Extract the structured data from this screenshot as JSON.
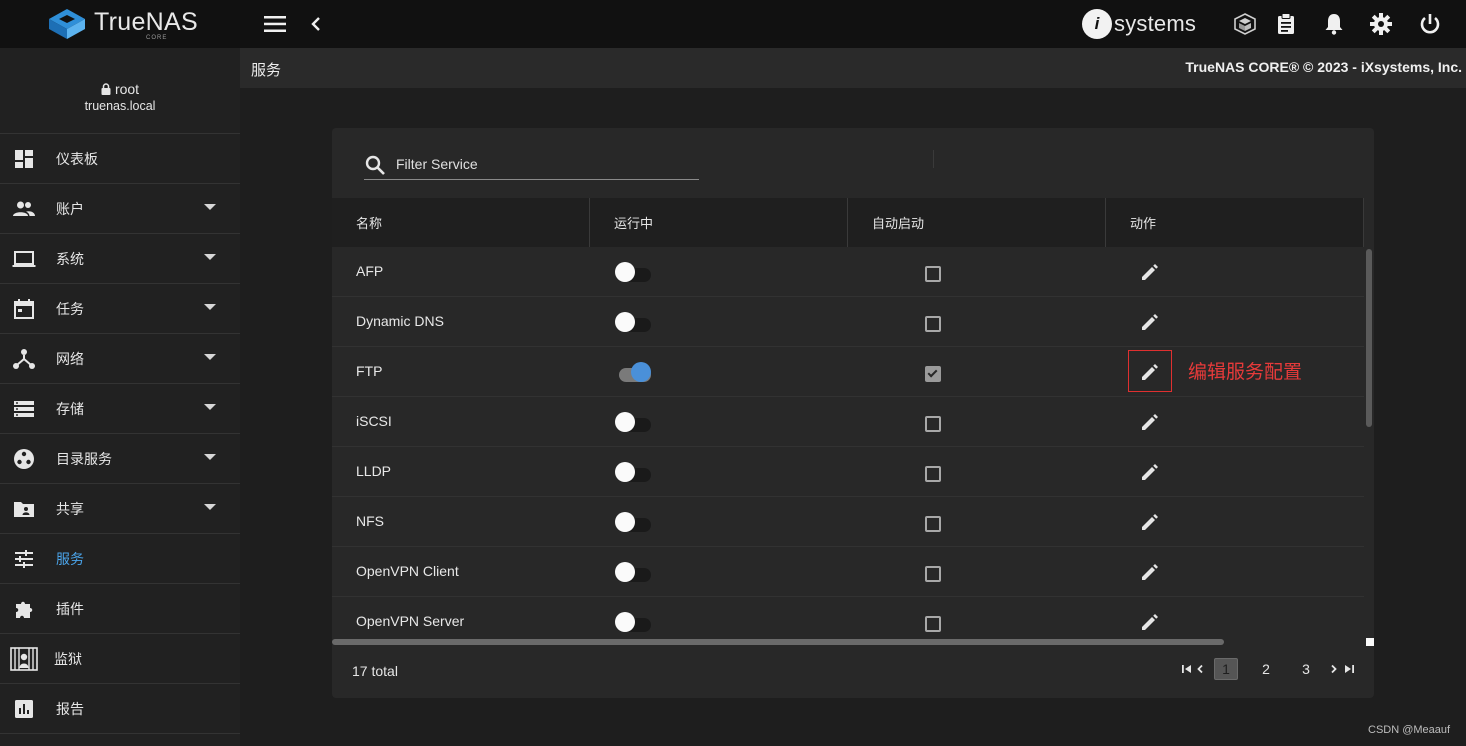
{
  "app": {
    "brand": "TrueNAS",
    "brand_sub": "CORE",
    "vendor_logo_i": "i",
    "vendor_logo_text": "systems"
  },
  "page": {
    "title": "服务",
    "copyright": "TrueNAS CORE® © 2023 - iXsystems, Inc."
  },
  "user": {
    "name": "root",
    "host": "truenas.local"
  },
  "sidebar": {
    "items": [
      {
        "label": "仪表板",
        "icon": "dashboard-icon",
        "expandable": false
      },
      {
        "label": "账户",
        "icon": "accounts-icon",
        "expandable": true
      },
      {
        "label": "系统",
        "icon": "laptop-icon",
        "expandable": true
      },
      {
        "label": "任务",
        "icon": "calendar-icon",
        "expandable": true
      },
      {
        "label": "网络",
        "icon": "network-icon",
        "expandable": true
      },
      {
        "label": "存储",
        "icon": "storage-icon",
        "expandable": true
      },
      {
        "label": "目录服务",
        "icon": "directory-icon",
        "expandable": true
      },
      {
        "label": "共享",
        "icon": "share-folder-icon",
        "expandable": true
      },
      {
        "label": "服务",
        "icon": "tune-icon",
        "expandable": false,
        "active": true
      },
      {
        "label": "插件",
        "icon": "puzzle-icon",
        "expandable": false
      },
      {
        "label": "监狱",
        "icon": "jail-icon",
        "expandable": false
      },
      {
        "label": "报告",
        "icon": "chart-icon",
        "expandable": false
      }
    ]
  },
  "services": {
    "filter_placeholder": "Filter Service",
    "columns": [
      "名称",
      "运行中",
      "自动启动",
      "动作"
    ],
    "rows": [
      {
        "name": "AFP",
        "running": false,
        "autostart": false
      },
      {
        "name": "Dynamic DNS",
        "running": false,
        "autostart": false
      },
      {
        "name": "FTP",
        "running": true,
        "autostart": true
      },
      {
        "name": "iSCSI",
        "running": false,
        "autostart": false
      },
      {
        "name": "LLDP",
        "running": false,
        "autostart": false
      },
      {
        "name": "NFS",
        "running": false,
        "autostart": false
      },
      {
        "name": "OpenVPN Client",
        "running": false,
        "autostart": false
      },
      {
        "name": "OpenVPN Server",
        "running": false,
        "autostart": false
      }
    ],
    "annotation": "编辑服务配置",
    "total": "17 total",
    "pages": [
      "1",
      "2",
      "3"
    ],
    "current_page": "1"
  },
  "colors": {
    "accent": "#4aa3e8",
    "toggle_on": "#4a90d9",
    "annotation": "#e63a3a"
  },
  "watermark": "CSDN @Meaauf"
}
